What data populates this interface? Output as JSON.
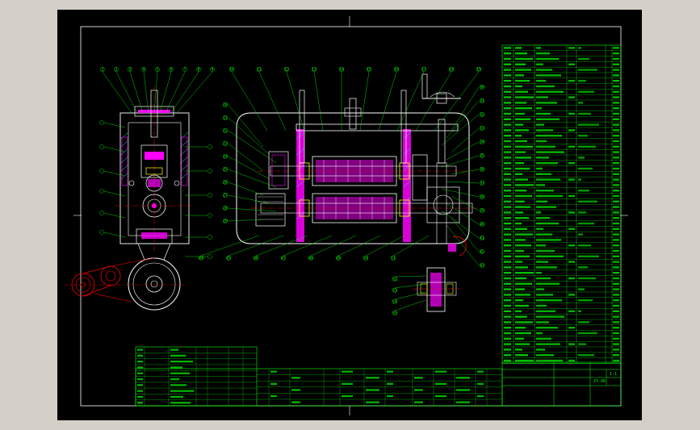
{
  "window": {
    "background": "#d4d0c8"
  },
  "colors": {
    "sheet": "#000000",
    "frame": "#ffffff",
    "outline": "#ffffff",
    "table_line": "#00ff00",
    "table_text": "#00ff00",
    "leader": "#00ff00",
    "section_fill": "#ff00ff",
    "hatch": "#00ffff",
    "centerline": "#ff0000",
    "bearing": "#ffff00"
  },
  "icons": {
    "side_view": "cross-section-side-view",
    "main_view": "cross-section-main-assembly",
    "pulley": "v-belt-pulley-drive",
    "handwheel": "hand-crank-wheel",
    "detail": "partial-detail-view"
  },
  "title_block": {
    "drawing_no": "ZY-00",
    "scale": "1:1"
  },
  "leader_labels": {
    "top": [
      "1",
      "2",
      "3",
      "4",
      "5",
      "6",
      "7",
      "8",
      "9",
      "10",
      "11",
      "12",
      "13",
      "14",
      "15",
      "16",
      "17",
      "18",
      "19"
    ],
    "left": [
      "20",
      "21",
      "22",
      "23",
      "24",
      "25",
      "26",
      "27",
      "28",
      "29"
    ],
    "right": [
      "30",
      "31",
      "32",
      "33",
      "34",
      "35",
      "36",
      "37",
      "38",
      "39",
      "40",
      "41",
      "42",
      "43"
    ],
    "bottom": [
      "44",
      "45",
      "46",
      "47",
      "48",
      "49",
      "50",
      "51",
      "52",
      "53",
      "54",
      "55"
    ]
  }
}
